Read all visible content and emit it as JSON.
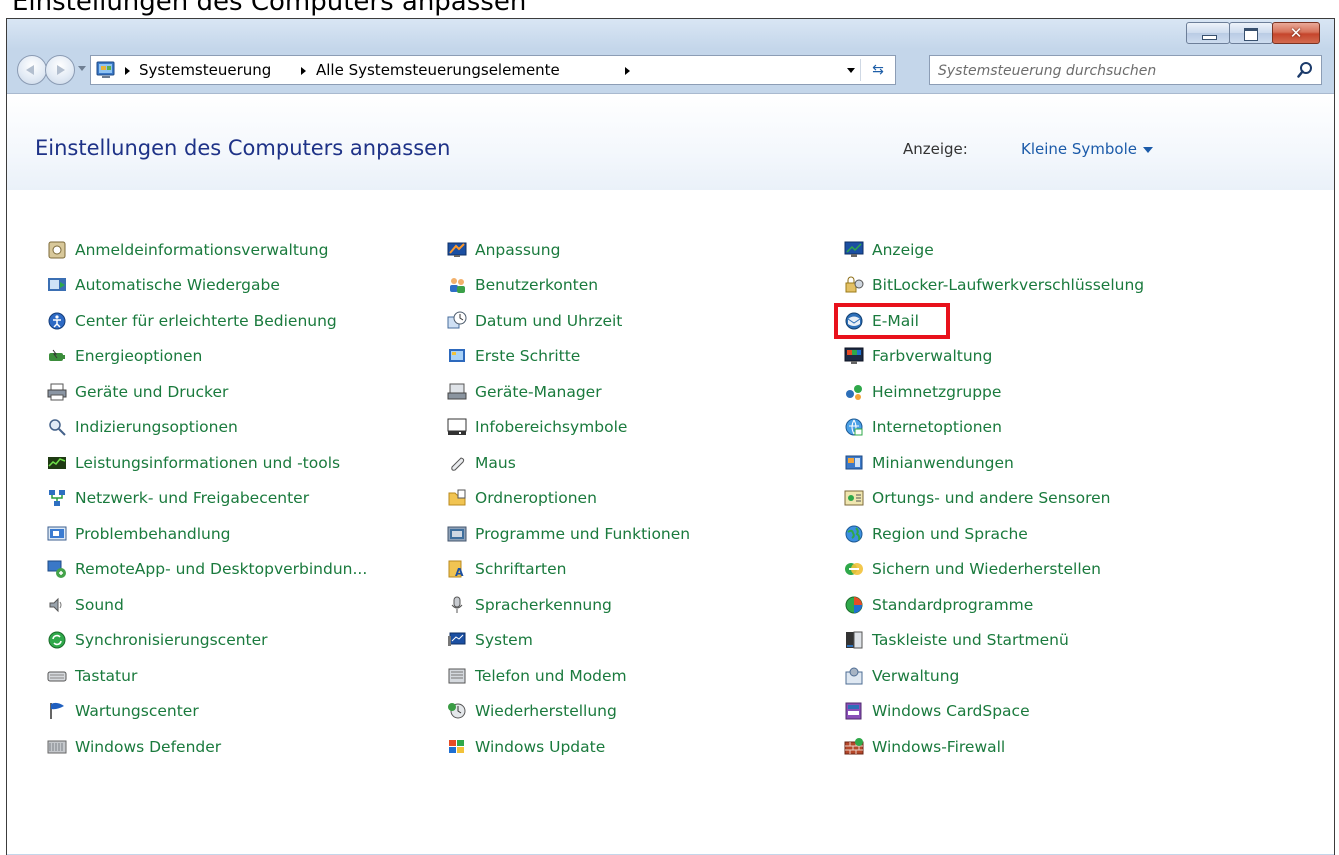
{
  "top_caption": "Einstellungen des Computers anpassen",
  "breadcrumb": [
    "Systemsteuerung",
    "Alle Systemsteuerungselemente"
  ],
  "search": {
    "placeholder": "Systemsteuerung durchsuchen"
  },
  "page_title": "Einstellungen des Computers anpassen",
  "view": {
    "label": "Anzeige:",
    "value": "Kleine Symbole"
  },
  "columns": [
    [
      {
        "label": "Anmeldeinformationsverwaltung",
        "icon": "vault-icon"
      },
      {
        "label": "Automatische Wiedergabe",
        "icon": "autoplay-icon"
      },
      {
        "label": "Center für erleichterte Bedienung",
        "icon": "ease-of-access-icon"
      },
      {
        "label": "Energieoptionen",
        "icon": "power-options-icon"
      },
      {
        "label": "Geräte und Drucker",
        "icon": "printer-icon"
      },
      {
        "label": "Indizierungsoptionen",
        "icon": "indexing-icon"
      },
      {
        "label": "Leistungsinformationen und -tools",
        "icon": "performance-icon"
      },
      {
        "label": "Netzwerk- und Freigabecenter",
        "icon": "network-icon"
      },
      {
        "label": "Problembehandlung",
        "icon": "troubleshooting-icon"
      },
      {
        "label": "RemoteApp- und Desktopverbindun...",
        "icon": "remoteapp-icon"
      },
      {
        "label": "Sound",
        "icon": "speaker-icon"
      },
      {
        "label": "Synchronisierungscenter",
        "icon": "sync-icon"
      },
      {
        "label": "Tastatur",
        "icon": "keyboard-icon"
      },
      {
        "label": "Wartungscenter",
        "icon": "flag-icon"
      },
      {
        "label": "Windows Defender",
        "icon": "defender-icon"
      }
    ],
    [
      {
        "label": "Anpassung",
        "icon": "personalization-icon"
      },
      {
        "label": "Benutzerkonten",
        "icon": "user-accounts-icon"
      },
      {
        "label": "Datum und Uhrzeit",
        "icon": "clock-icon"
      },
      {
        "label": "Erste Schritte",
        "icon": "getting-started-icon"
      },
      {
        "label": "Geräte-Manager",
        "icon": "device-manager-icon"
      },
      {
        "label": "Infobereichsymbole",
        "icon": "notification-area-icon"
      },
      {
        "label": "Maus",
        "icon": "mouse-icon"
      },
      {
        "label": "Ordneroptionen",
        "icon": "folder-options-icon"
      },
      {
        "label": "Programme und Funktionen",
        "icon": "programs-icon"
      },
      {
        "label": "Schriftarten",
        "icon": "fonts-icon"
      },
      {
        "label": "Spracherkennung",
        "icon": "microphone-icon"
      },
      {
        "label": "System",
        "icon": "system-icon"
      },
      {
        "label": "Telefon und Modem",
        "icon": "phone-modem-icon"
      },
      {
        "label": "Wiederherstellung",
        "icon": "recovery-icon"
      },
      {
        "label": "Windows Update",
        "icon": "windows-update-icon"
      }
    ],
    [
      {
        "label": "Anzeige",
        "icon": "display-icon"
      },
      {
        "label": "BitLocker-Laufwerkverschlüsselung",
        "icon": "bitlocker-icon"
      },
      {
        "label": "E-Mail",
        "icon": "mail-icon",
        "highlighted": true
      },
      {
        "label": "Farbverwaltung",
        "icon": "color-management-icon"
      },
      {
        "label": "Heimnetzgruppe",
        "icon": "homegroup-icon"
      },
      {
        "label": "Internetoptionen",
        "icon": "internet-options-icon"
      },
      {
        "label": "Minianwendungen",
        "icon": "gadgets-icon"
      },
      {
        "label": "Ortungs- und andere Sensoren",
        "icon": "sensors-icon"
      },
      {
        "label": "Region und Sprache",
        "icon": "globe-icon"
      },
      {
        "label": "Sichern und Wiederherstellen",
        "icon": "backup-icon"
      },
      {
        "label": "Standardprogramme",
        "icon": "default-programs-icon"
      },
      {
        "label": "Taskleiste und Startmenü",
        "icon": "taskbar-icon"
      },
      {
        "label": "Verwaltung",
        "icon": "admin-tools-icon"
      },
      {
        "label": "Windows CardSpace",
        "icon": "cardspace-icon"
      },
      {
        "label": "Windows-Firewall",
        "icon": "firewall-icon"
      }
    ]
  ],
  "colors": {
    "title": "#1e3287",
    "link": "#1a7a3d",
    "view_link": "#1c5ba9",
    "highlight": "#e8111b"
  }
}
